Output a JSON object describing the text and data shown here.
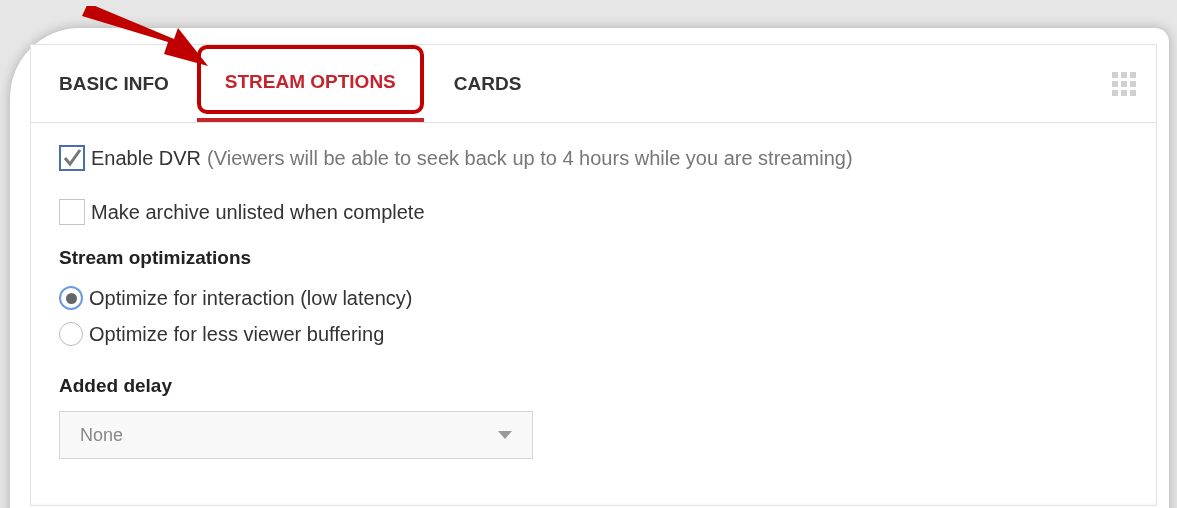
{
  "tabs": [
    {
      "label": "BASIC INFO",
      "selected": false
    },
    {
      "label": "STREAM OPTIONS",
      "selected": true
    },
    {
      "label": "CARDS",
      "selected": false
    }
  ],
  "options": [
    {
      "kind": "checkbox",
      "label": "Enable DVR",
      "note": "(Viewers will be able to seek back up to 4 hours while you are streaming)",
      "checked": true
    },
    {
      "kind": "checkbox",
      "label": "Make archive unlisted when complete",
      "checked": false
    }
  ],
  "optimizations": {
    "heading": "Stream optimizations",
    "choices": [
      {
        "label": "Optimize for interaction (low latency)",
        "selected": true
      },
      {
        "label": "Optimize for less viewer buffering",
        "selected": false
      }
    ]
  },
  "delay": {
    "heading": "Added delay",
    "value": "None"
  }
}
